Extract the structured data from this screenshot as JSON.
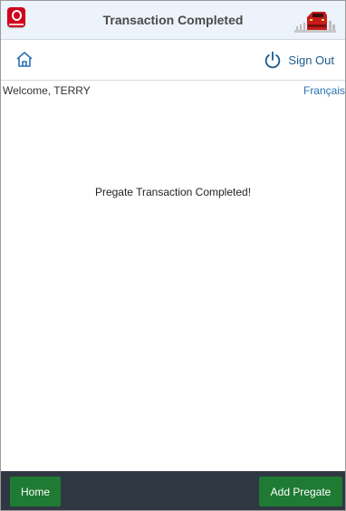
{
  "header": {
    "title": "Transaction Completed",
    "logo_icon": "app-logo-icon",
    "brand_image": "train-locomotive-image"
  },
  "toolbar": {
    "home_icon": "home-icon",
    "signout_icon": "power-icon",
    "signout_label": "Sign Out"
  },
  "user": {
    "welcome": "Welcome, TERRY",
    "language_link": "Français"
  },
  "main": {
    "message": "Pregate Transaction Completed!"
  },
  "footer": {
    "home_label": "Home",
    "add_label": "Add Pregate"
  },
  "colors": {
    "header_bg": "#edf3fa",
    "footer_bg": "#2f3842",
    "button_green": "#1f7a33",
    "link_blue": "#2a72b5",
    "logo_red": "#d0021b"
  }
}
